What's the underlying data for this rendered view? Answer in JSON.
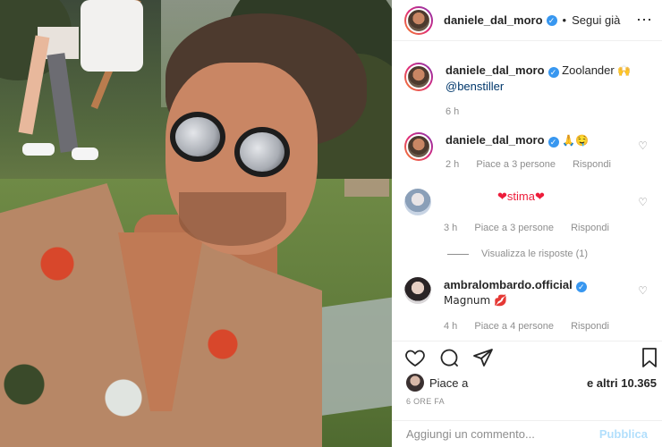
{
  "post": {
    "photo_alt": "selfie photo",
    "author": "daniele_dal_moro",
    "follow_status": "Segui già",
    "caption_text": "Zoolander",
    "caption_emoji": "🙌",
    "caption_mention": "@benstiller",
    "caption_time": "6 h"
  },
  "comments": [
    {
      "user": "daniele_dal_moro",
      "verified": true,
      "text": "🙏🤤",
      "time": "2 h",
      "likes": "Piace a 3 persone",
      "reply": "Rispondi"
    },
    {
      "user": "",
      "verified": false,
      "text": "❤stima❤",
      "time": "3 h",
      "likes": "Piace a 3 persone",
      "reply": "Rispondi",
      "view_replies": "Visualizza le risposte (1)"
    },
    {
      "user": "ambralombardo.official",
      "verified": true,
      "text": "Magnum 💋",
      "time": "4 h",
      "likes": "Piace a 4 persone",
      "reply": "Rispondi"
    }
  ],
  "likes_bar": {
    "prefix": "Piace a",
    "others": "e altri 10.365"
  },
  "time_ago": "6 ORE FA",
  "add_comment": {
    "placeholder": "Aggiungi un commento...",
    "publish": "Pubblica"
  },
  "colors": {
    "verified": "#3897f0",
    "publish_disabled": "#b2dffc",
    "meta_gray": "#8e8e8e"
  },
  "icons": [
    "more-icon",
    "heart-icon",
    "comment-icon",
    "share-icon",
    "bookmark-icon",
    "verified-icon"
  ]
}
